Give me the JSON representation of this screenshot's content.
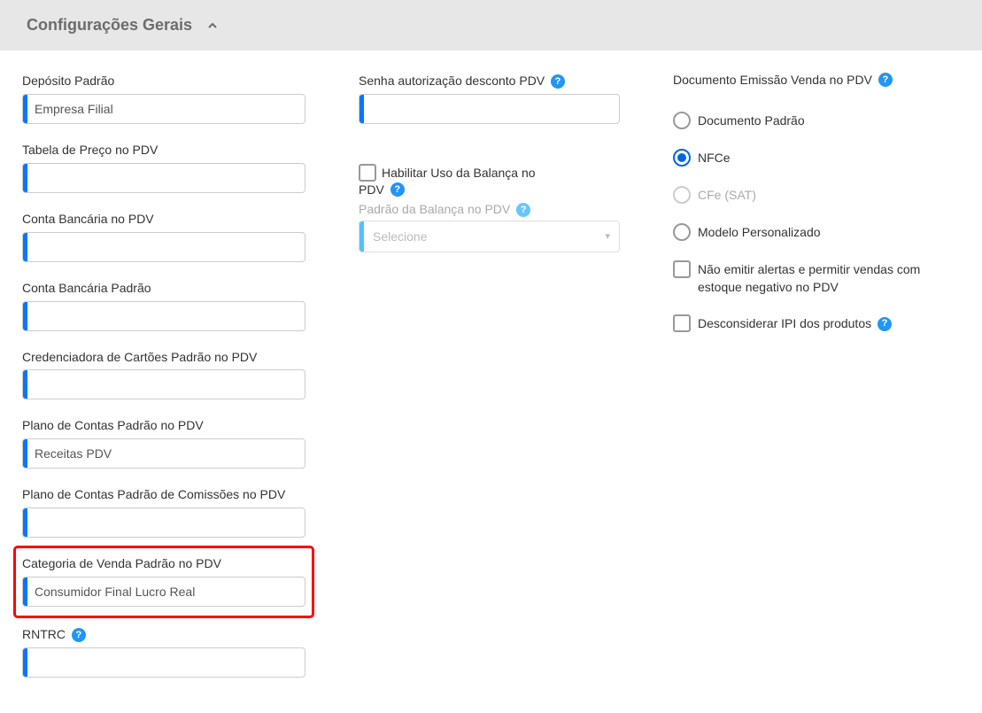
{
  "header": {
    "title": "Configurações Gerais"
  },
  "col1": {
    "deposito_label": "Depósito Padrão",
    "deposito_value": "Empresa Filial",
    "tabela_label": "Tabela de Preço no PDV",
    "tabela_value": "",
    "conta_pdv_label": "Conta Bancária no PDV",
    "conta_pdv_value": "",
    "conta_padrao_label": "Conta Bancária Padrão",
    "conta_padrao_value": "",
    "credenciadora_label": "Credenciadora de Cartões Padrão no PDV",
    "credenciadora_value": "",
    "plano_pdv_label": "Plano de Contas Padrão no PDV",
    "plano_pdv_value": "Receitas PDV",
    "plano_comissoes_label": "Plano de Contas Padrão de Comissões no PDV",
    "plano_comissoes_value": "",
    "categoria_label": "Categoria de Venda Padrão no PDV",
    "categoria_value": "Consumidor Final Lucro Real",
    "rntrc_label": "RNTRC",
    "rntrc_value": ""
  },
  "col2": {
    "senha_label": "Senha autorização desconto PDV",
    "senha_value": "",
    "balanca_checkbox": "Habilitar Uso da Balança no PDV",
    "balanca_padrao_label": "Padrão da Balança no PDV",
    "balanca_padrao_placeholder": "Selecione"
  },
  "col3": {
    "doc_label": "Documento Emissão Venda no PDV",
    "radio_doc_padrao": "Documento Padrão",
    "radio_nfce": "NFCe",
    "radio_cfe": "CFe (SAT)",
    "radio_modelo": "Modelo Personalizado",
    "check_estoque": "Não emitir alertas e permitir vendas com estoque negativo no PDV",
    "check_ipi": "Desconsiderar IPI dos produtos"
  }
}
